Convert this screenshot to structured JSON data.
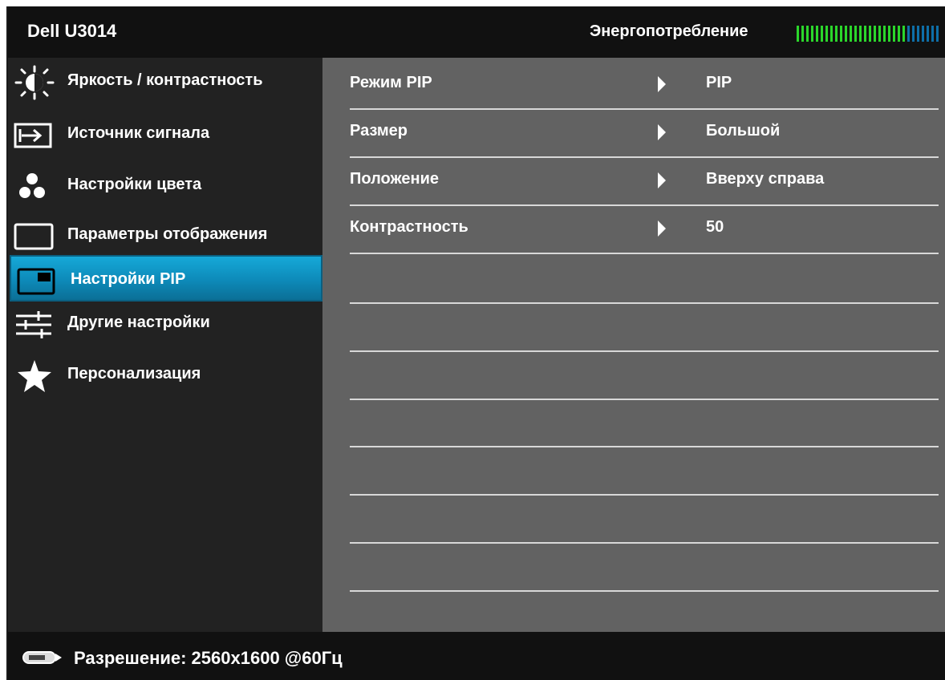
{
  "header": {
    "model": "Dell U3014",
    "power_label": "Энергопотребление",
    "power_level_fraction": 0.78,
    "power_on_color": "#2bd62b",
    "power_off_color": "#0e6fa8"
  },
  "sidebar": {
    "items": [
      {
        "label": "Яркость / контрастность",
        "icon": "brightness-icon"
      },
      {
        "label": "Источник сигнала",
        "icon": "input-source-icon"
      },
      {
        "label": "Настройки цвета",
        "icon": "color-dots-icon"
      },
      {
        "label": "Параметры отображения",
        "icon": "display-rect-icon"
      },
      {
        "label": "Настройки PIP",
        "icon": "pip-icon",
        "active": true
      },
      {
        "label": "Другие настройки",
        "icon": "sliders-icon"
      },
      {
        "label": "Персонализация",
        "icon": "star-icon"
      }
    ],
    "active_color": "#16a9d8"
  },
  "main": {
    "rows": [
      {
        "label": "Режим PIP",
        "value": "PIP"
      },
      {
        "label": "Размер",
        "value": "Большой"
      },
      {
        "label": "Положение",
        "value": "Вверху справа"
      },
      {
        "label": "Контрастность",
        "value": "50"
      }
    ]
  },
  "footer": {
    "resolution": "Разрешение: 2560x1600 @60Гц",
    "icon": "connector-icon"
  }
}
